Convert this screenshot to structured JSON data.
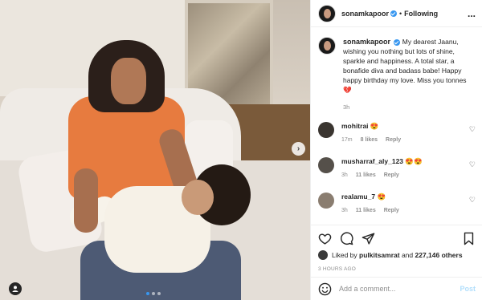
{
  "post": {
    "author": "sonamkapoor",
    "follow_state": "Following",
    "separator": "•",
    "more_label": "...",
    "caption": "My dearest Jaanu, wishing you nothing but lots of shine, sparkle and happiness. A total star, a bonafide diva and badass babe! Happy happy birthday my love. Miss you tonnes 💔",
    "caption_age": "3h",
    "carousel_next": "›",
    "carousel_dots": 3,
    "carousel_active": 1
  },
  "comments": [
    {
      "user": "mohitrai",
      "text": "😍",
      "age": "17m",
      "likes": "8 likes",
      "reply": "Reply",
      "avatar_color": "#3a3530"
    },
    {
      "user": "musharraf_aly_123",
      "text": "😍😍",
      "age": "3h",
      "likes": "11 likes",
      "reply": "Reply",
      "avatar_color": "#55504a"
    },
    {
      "user": "realamu_7",
      "text": "😍",
      "age": "3h",
      "likes": "11 likes",
      "reply": "Reply",
      "avatar_color": "#8a7d70"
    }
  ],
  "engagement": {
    "liked_by_prefix": "Liked by ",
    "liked_by_user": "pulkitsamrat",
    "and_label": " and ",
    "others_count": "227,146 others",
    "posted_ago": "3 HOURS AGO"
  },
  "composer": {
    "placeholder": "Add a comment...",
    "post_label": "Post"
  },
  "colors": {
    "accent": "#3897f0",
    "post_disabled": "#b2dffc",
    "muted": "#8e8e8e"
  }
}
